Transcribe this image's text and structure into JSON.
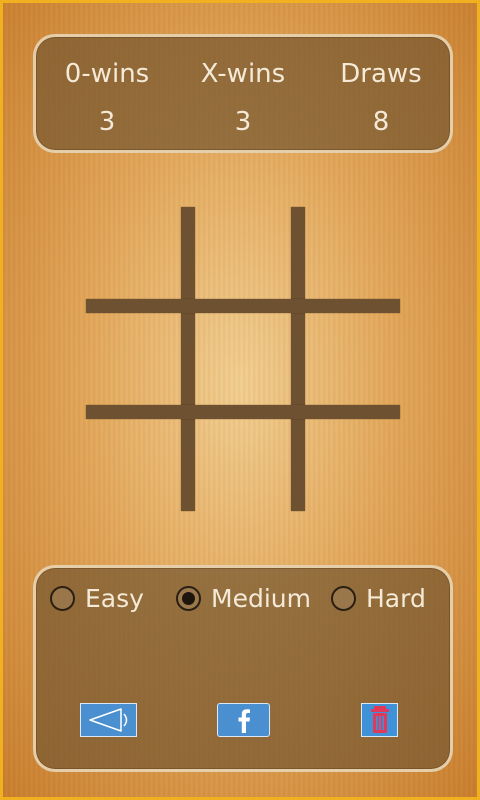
{
  "score": {
    "o_label": "0-wins",
    "o_value": "3",
    "x_label": "X-wins",
    "x_value": "3",
    "draws_label": "Draws",
    "draws_value": "8"
  },
  "board": {
    "cells": [
      "",
      "",
      "",
      "",
      "",
      "",
      "",
      "",
      ""
    ]
  },
  "difficulty": {
    "options": [
      {
        "label": "Easy",
        "selected": false
      },
      {
        "label": "Medium",
        "selected": true
      },
      {
        "label": "Hard",
        "selected": false
      }
    ]
  },
  "actions": {
    "sound_icon": "speaker-icon",
    "facebook_icon": "facebook-icon",
    "delete_icon": "trash-icon"
  },
  "colors": {
    "frame": "#f0b020",
    "panel": "#76582f",
    "grid": "#6e5130",
    "button": "#4a8fd0",
    "trash": "#e0395a"
  }
}
